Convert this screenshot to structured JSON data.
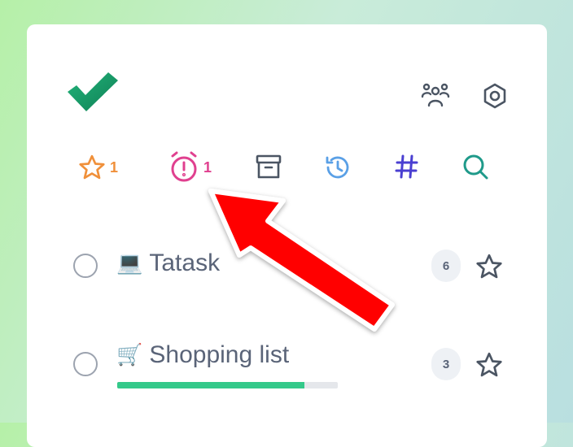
{
  "app": {
    "brand_color": "#16a06a"
  },
  "header": {
    "icons": [
      "people-icon",
      "settings-hex-icon"
    ]
  },
  "toolbar": {
    "starred": {
      "icon": "star-icon",
      "count": "1",
      "color": "#f0903a"
    },
    "reminders": {
      "icon": "alarm-clock-icon",
      "count": "1",
      "color": "#e0408f"
    },
    "archive": {
      "icon": "archive-box-icon",
      "color": "#4b5563"
    },
    "history": {
      "icon": "history-icon",
      "color": "#5aa0e6"
    },
    "tags": {
      "icon": "hashtag-icon",
      "color": "#4a3fd1"
    },
    "search": {
      "icon": "search-icon",
      "color": "#1f9a8a"
    }
  },
  "lists": [
    {
      "emoji": "💻",
      "title": "Tatask",
      "count": "6"
    },
    {
      "emoji": "🛒",
      "title": "Shopping list",
      "count": "3",
      "progress": 0.85
    }
  ],
  "annotation": {
    "type": "arrow",
    "color": "#ff0000",
    "points_to": "reminders"
  }
}
